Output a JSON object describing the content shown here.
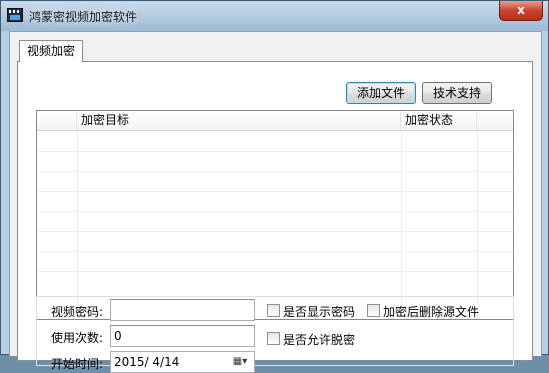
{
  "window": {
    "title": "鸿蒙密视频加密软件",
    "close_symbol": "x"
  },
  "tabs": [
    {
      "label": "视频加密"
    }
  ],
  "toolbar": {
    "add_file": "添加文件",
    "tech_support": "技术支持"
  },
  "list": {
    "columns": [
      "加密目标",
      "加密状态"
    ],
    "rows": []
  },
  "form": {
    "video_password_label": "视频密码:",
    "video_password_value": "",
    "usage_count_label": "使用次数:",
    "usage_count_value": "0",
    "start_time_label": "开始时间:",
    "start_time_value": "2015/ 4/14",
    "show_password_label": "是否显示密码",
    "delete_source_label": "加密后删除源文件",
    "allow_offline_label": "是否允许脱密"
  }
}
